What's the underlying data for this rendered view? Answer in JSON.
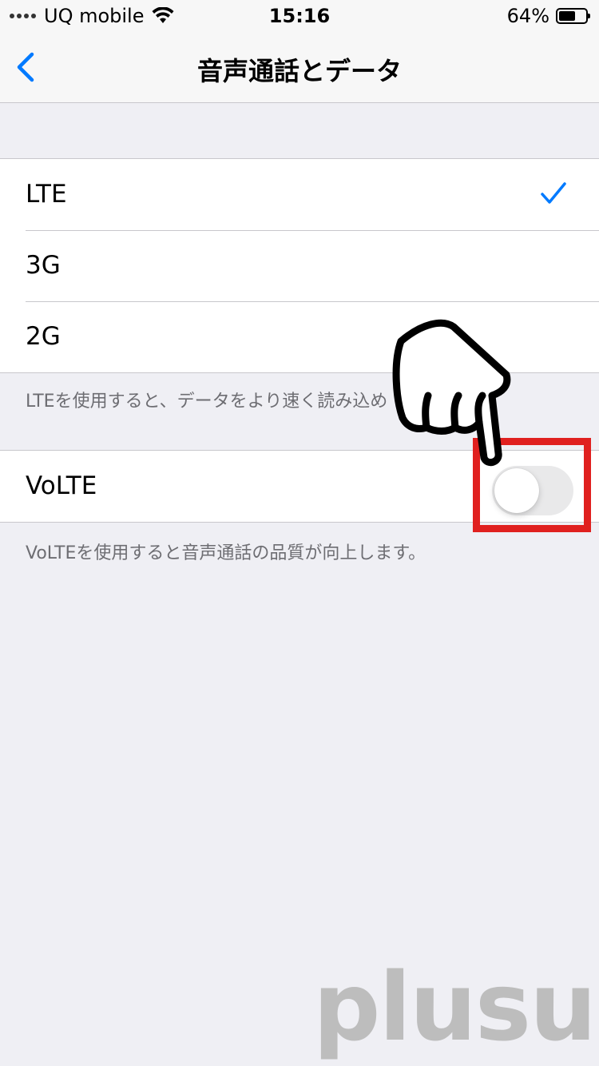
{
  "status_bar": {
    "carrier": "UQ mobile",
    "time": "15:16",
    "battery_percent": "64%",
    "battery_level": 0.64,
    "signal_icon": "signal-dots-icon",
    "wifi_icon": "wifi-icon"
  },
  "nav": {
    "title": "音声通話とデータ",
    "back_icon": "chevron-left-icon"
  },
  "network_options": {
    "items": [
      {
        "label": "LTE",
        "selected": true
      },
      {
        "label": "3G",
        "selected": false
      },
      {
        "label": "2G",
        "selected": false
      }
    ],
    "footer": "LTEを使用すると、データをより速く読み込め"
  },
  "volte": {
    "label": "VoLTE",
    "enabled": false,
    "footer": "VoLTEを使用すると音声通話の品質が向上します。"
  },
  "annotations": {
    "highlight_color": "#e0201f",
    "pointer": "pointing-hand-icon"
  },
  "watermark": "plusul",
  "colors": {
    "accent": "#007aff",
    "background": "#efeff4",
    "toggle_off": "#e9e9ea"
  }
}
